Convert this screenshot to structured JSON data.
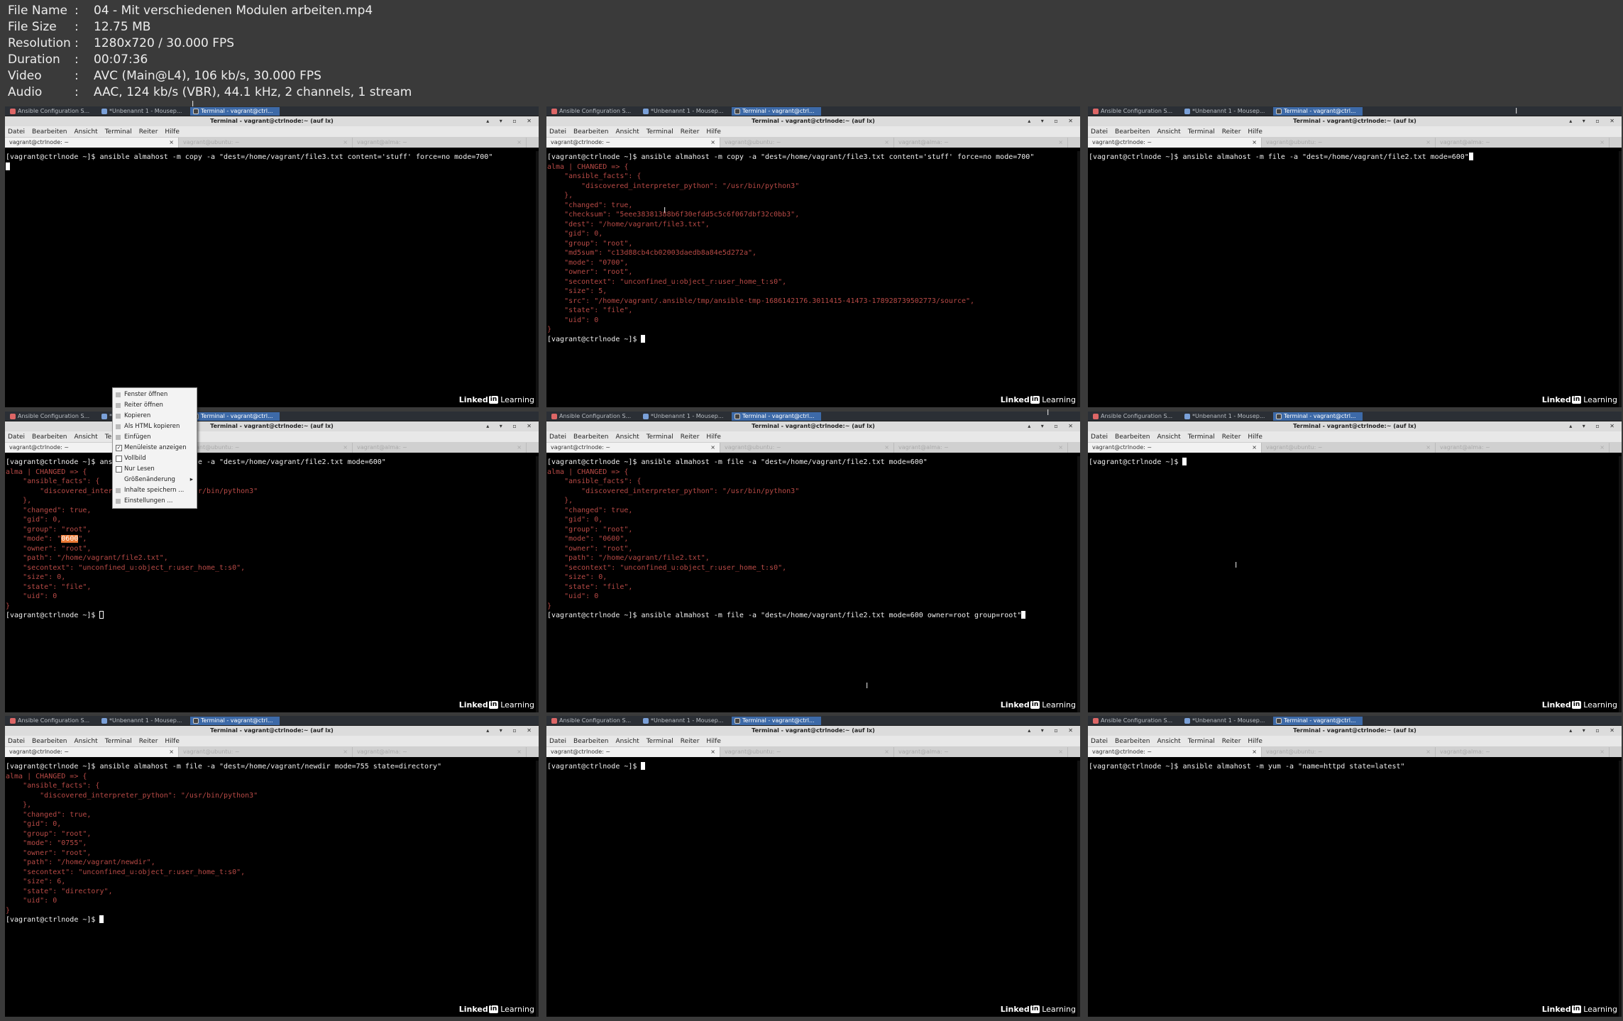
{
  "info": [
    {
      "label": "File Name",
      "value": "04 - Mit verschiedenen Modulen arbeiten.mp4"
    },
    {
      "label": "File Size",
      "value": "12.75 MB"
    },
    {
      "label": "Resolution",
      "value": "1280x720 / 30.000 FPS"
    },
    {
      "label": "Duration",
      "value": "00:07:36"
    },
    {
      "label": "Video",
      "value": "AVC (Main@L4), 106 kb/s, 30.000 FPS"
    },
    {
      "label": "Audio",
      "value": "AAC, 124 kb/s (VBR), 44.1 kHz, 2 channels, 1 stream"
    }
  ],
  "taskbar": [
    "Ansible Configuration S...",
    "*Unbenannt 1 - Mousep...",
    "Terminal - vagrant@ctrl..."
  ],
  "window_title": "Terminal - vagrant@ctrlnode:~ (auf lx)",
  "window_controls": "▴ ▾ ▫ ✕",
  "menu": [
    "Datei",
    "Bearbeiten",
    "Ansicht",
    "Terminal",
    "Reiter",
    "Hilfe"
  ],
  "tabs": [
    "vagrant@ctrlnode: ~",
    "vagrant@ubuntu: ~",
    "vagrant@alma: ~"
  ],
  "tab_close": "×",
  "watermark": {
    "brand": "Linked",
    "box": "in",
    "suffix": "Learning"
  },
  "context_menu": [
    {
      "label": "Fenster öffnen",
      "kind": "icon"
    },
    {
      "label": "Reiter öffnen",
      "kind": "icon"
    },
    {
      "label": "Kopieren",
      "kind": "icon"
    },
    {
      "label": "Als HTML kopieren",
      "kind": "icon"
    },
    {
      "label": "Einfügen",
      "kind": "icon"
    },
    {
      "label": "Menüleiste anzeigen",
      "kind": "check",
      "checked": true
    },
    {
      "label": "Vollbild",
      "kind": "check",
      "checked": false
    },
    {
      "label": "Nur Lesen",
      "kind": "check",
      "checked": false
    },
    {
      "label": "Größenänderung",
      "kind": "submenu"
    },
    {
      "label": "Inhalte speichern ...",
      "kind": "icon"
    },
    {
      "label": "Einstellungen ...",
      "kind": "icon"
    }
  ],
  "frames": [
    {
      "lines": [
        {
          "t": "[vagrant@ctrlnode ~]$ ansible almahost -m copy -a \"dest=/home/vagrant/file3.txt content='stuff' force=no mode=700\"",
          "c": "cmd"
        },
        {
          "t": "",
          "c": "cmd",
          "cursor": "solid"
        }
      ]
    },
    {
      "lines": [
        {
          "t": "[vagrant@ctrlnode ~]$ ansible almahost -m copy -a \"dest=/home/vagrant/file3.txt content='stuff' force=no mode=700\"",
          "c": "cmd"
        },
        {
          "t": "alma | CHANGED => {",
          "c": "out"
        },
        {
          "t": "    \"ansible_facts\": {",
          "c": "out"
        },
        {
          "t": "        \"discovered_interpreter_python\": \"/usr/bin/python3\"",
          "c": "out"
        },
        {
          "t": "    },",
          "c": "out"
        },
        {
          "t": "    \"changed\": true,",
          "c": "out"
        },
        {
          "t": "    \"checksum\": \"5eee38381388b6f30efdd5c5c6f067dbf32c0bb3\",",
          "c": "out"
        },
        {
          "t": "    \"dest\": \"/home/vagrant/file3.txt\",",
          "c": "out"
        },
        {
          "t": "    \"gid\": 0,",
          "c": "out"
        },
        {
          "t": "    \"group\": \"root\",",
          "c": "out"
        },
        {
          "t": "    \"md5sum\": \"c13d88cb4cb02003daedb8a84e5d272a\",",
          "c": "out"
        },
        {
          "t": "    \"mode\": \"0700\",",
          "c": "out"
        },
        {
          "t": "    \"owner\": \"root\",",
          "c": "out"
        },
        {
          "t": "    \"secontext\": \"unconfined_u:object_r:user_home_t:s0\",",
          "c": "out"
        },
        {
          "t": "    \"size\": 5,",
          "c": "out"
        },
        {
          "t": "    \"src\": \"/home/vagrant/.ansible/tmp/ansible-tmp-1686142176.3011415-41473-178928739502773/source\",",
          "c": "out"
        },
        {
          "t": "    \"state\": \"file\",",
          "c": "out"
        },
        {
          "t": "    \"uid\": 0",
          "c": "out"
        },
        {
          "t": "}",
          "c": "out"
        },
        {
          "t": "[vagrant@ctrlnode ~]$ ",
          "c": "cmd",
          "cursor": "solid"
        }
      ]
    },
    {
      "lines": [
        {
          "t": "[vagrant@ctrlnode ~]$ ansible almahost -m file -a \"dest=/home/vagrant/file2.txt mode=600\"",
          "c": "cmd",
          "cursor": "solid"
        }
      ]
    },
    {
      "lines": [
        {
          "t": "[vagrant@ctrlnode ~]$ ansible almahost -m file -a \"dest=/home/vagrant/file2.txt mode=600\"",
          "c": "cmd"
        },
        {
          "t": "alma | CHANGED => {",
          "c": "out"
        },
        {
          "t": "    \"ansible_facts\": {",
          "c": "out"
        },
        {
          "t": "        \"discovered_interpreter_python\": \"/usr/bin/python3\"",
          "c": "out"
        },
        {
          "t": "    },",
          "c": "out"
        },
        {
          "t": "    \"changed\": true,",
          "c": "out"
        },
        {
          "t": "    \"gid\": 0,",
          "c": "out"
        },
        {
          "t": "    \"group\": \"root\",",
          "c": "out"
        },
        {
          "t": "    \"mode\": \"0600\",",
          "c": "out"
        },
        {
          "t": "    \"owner\": \"root\",",
          "c": "out"
        },
        {
          "t": "    \"path\": \"/home/vagrant/file2.txt\",",
          "c": "out"
        },
        {
          "t": "    \"secontext\": \"unconfined_u:object_r:user_home_t:s0\",",
          "c": "out"
        },
        {
          "t": "    \"size\": 0,",
          "c": "out"
        },
        {
          "t": "    \"state\": \"file\",",
          "c": "out"
        },
        {
          "t": "    \"uid\": 0",
          "c": "out"
        },
        {
          "t": "}",
          "c": "out"
        },
        {
          "t": "[vagrant@ctrlnode ~]$ ",
          "c": "cmd",
          "cursor": "hollow"
        }
      ]
    },
    {
      "lines": [
        {
          "t": "[vagrant@ctrlnode ~]$ ansible almahost -m file -a \"dest=/home/vagrant/file2.txt mode=600\"",
          "c": "cmd"
        },
        {
          "t": "alma | CHANGED => {",
          "c": "out"
        },
        {
          "t": "    \"ansible_facts\": {",
          "c": "out"
        },
        {
          "t": "        \"discovered_interpreter_python\": \"/usr/bin/python3\"",
          "c": "out"
        },
        {
          "t": "    },",
          "c": "out"
        },
        {
          "t": "    \"changed\": true,",
          "c": "out"
        },
        {
          "t": "    \"gid\": 0,",
          "c": "out"
        },
        {
          "t": "    \"group\": \"root\",",
          "c": "out"
        },
        {
          "t": "    \"mode\": \"0600\",",
          "c": "out"
        },
        {
          "t": "    \"owner\": \"root\",",
          "c": "out"
        },
        {
          "t": "    \"path\": \"/home/vagrant/file2.txt\",",
          "c": "out"
        },
        {
          "t": "    \"secontext\": \"unconfined_u:object_r:user_home_t:s0\",",
          "c": "out"
        },
        {
          "t": "    \"size\": 0,",
          "c": "out"
        },
        {
          "t": "    \"state\": \"file\",",
          "c": "out"
        },
        {
          "t": "    \"uid\": 0",
          "c": "out"
        },
        {
          "t": "}",
          "c": "out"
        },
        {
          "t": "[vagrant@ctrlnode ~]$ ansible almahost -m file -a \"dest=/home/vagrant/file2.txt mode=600 owner=root group=root\"",
          "c": "cmd",
          "cursor": "solid"
        }
      ]
    },
    {
      "lines": [
        {
          "t": "[vagrant@ctrlnode ~]$ ",
          "c": "cmd",
          "cursor": "solid"
        }
      ]
    },
    {
      "lines": [
        {
          "t": "[vagrant@ctrlnode ~]$ ansible almahost -m file -a \"dest=/home/vagrant/newdir mode=755 state=directory\"",
          "c": "cmd"
        },
        {
          "t": "alma | CHANGED => {",
          "c": "out"
        },
        {
          "t": "    \"ansible_facts\": {",
          "c": "out"
        },
        {
          "t": "        \"discovered_interpreter_python\": \"/usr/bin/python3\"",
          "c": "out"
        },
        {
          "t": "    },",
          "c": "out"
        },
        {
          "t": "    \"changed\": true,",
          "c": "out"
        },
        {
          "t": "    \"gid\": 0,",
          "c": "out"
        },
        {
          "t": "    \"group\": \"root\",",
          "c": "out"
        },
        {
          "t": "    \"mode\": \"0755\",",
          "c": "out"
        },
        {
          "t": "    \"owner\": \"root\",",
          "c": "out"
        },
        {
          "t": "    \"path\": \"/home/vagrant/newdir\",",
          "c": "out"
        },
        {
          "t": "    \"secontext\": \"unconfined_u:object_r:user_home_t:s0\",",
          "c": "out"
        },
        {
          "t": "    \"size\": 6,",
          "c": "out"
        },
        {
          "t": "    \"state\": \"directory\",",
          "c": "out"
        },
        {
          "t": "    \"uid\": 0",
          "c": "out"
        },
        {
          "t": "}",
          "c": "out"
        },
        {
          "t": "[vagrant@ctrlnode ~]$ ",
          "c": "cmd",
          "cursor": "solid"
        }
      ]
    },
    {
      "lines": [
        {
          "t": "[vagrant@ctrlnode ~]$ ",
          "c": "cmd",
          "cursor": "solid"
        }
      ]
    },
    {
      "lines": [
        {
          "t": "[vagrant@ctrlnode ~]$ ansible almahost -m yum -a \"name=httpd state=latest\"",
          "c": "cmd"
        }
      ]
    }
  ]
}
